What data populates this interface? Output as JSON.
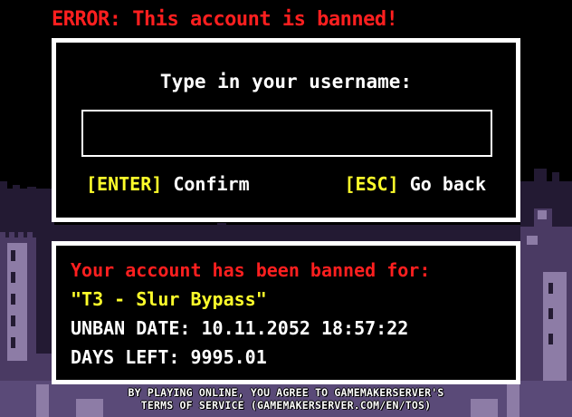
{
  "error": {
    "message": "ERROR: This account is banned!"
  },
  "login": {
    "prompt": "Type in your username:",
    "username_value": "",
    "confirm_key": "[ENTER]",
    "confirm_label": "Confirm",
    "back_key": "[ESC]",
    "back_label": "Go back"
  },
  "ban": {
    "title": "Your account has been banned for:",
    "reason": "\"T3 - Slur Bypass\"",
    "unban_date": "UNBAN DATE: 10.11.2052 18:57:22",
    "days_left": "DAYS LEFT: 9995.01"
  },
  "footer": {
    "tos_line1": "BY PLAYING ONLINE, YOU AGREE TO GAMEMAKERSERVER'S",
    "tos_line2": "TERMS OF SERVICE (GAMEMAKERSERVER.COM/EN/TOS)"
  },
  "colors": {
    "error_red": "#ff1f1f",
    "key_yellow": "#ffff2b",
    "panel_border": "#ffffff",
    "castle_purple": "#2e2340",
    "castle_light": "#8d7ca6"
  }
}
